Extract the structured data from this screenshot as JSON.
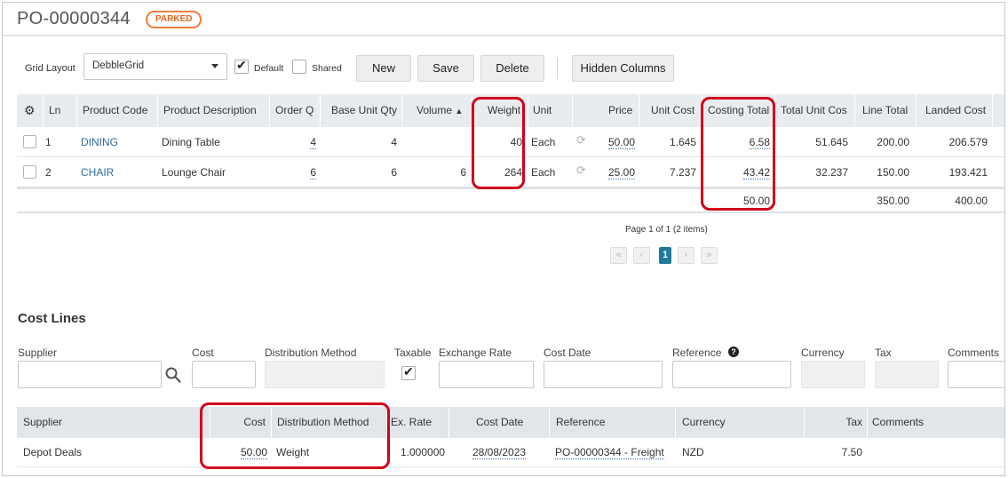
{
  "header": {
    "title": "PO-00000344",
    "status_badge": "PARKED"
  },
  "toolbar": {
    "grid_layout_label": "Grid Layout",
    "grid_layout_value": "DebbleGrid",
    "default_label": "Default",
    "default_checked": true,
    "shared_label": "Shared",
    "shared_checked": false,
    "new_label": "New",
    "save_label": "Save",
    "delete_label": "Delete",
    "hidden_columns_label": "Hidden Columns"
  },
  "lines_grid": {
    "columns": [
      "Ln",
      "Product Code",
      "Product Description",
      "Order Q",
      "Base Unit Qty",
      "Volume",
      "Weight",
      "Unit",
      "Price",
      "Unit Cost",
      "Costing Total",
      "Total Unit Cos",
      "Line Total",
      "Landed Cost"
    ],
    "sort_indicator": "▲",
    "rows": [
      {
        "ln": "1",
        "code": "DINING",
        "description": "Dining Table",
        "order_qty": "4",
        "base_unit_qty": "4",
        "volume": "",
        "weight": "40",
        "unit": "Each",
        "price": "50.00",
        "unit_cost": "1.645",
        "costing_total": "6.58",
        "total_unit_cost": "51.645",
        "line_total": "200.00",
        "landed_cost": "206.579"
      },
      {
        "ln": "2",
        "code": "CHAIR",
        "description": "Lounge Chair",
        "order_qty": "6",
        "base_unit_qty": "6",
        "volume": "6",
        "weight": "264",
        "unit": "Each",
        "price": "25.00",
        "unit_cost": "7.237",
        "costing_total": "43.42",
        "total_unit_cost": "32.237",
        "line_total": "150.00",
        "landed_cost": "193.421"
      }
    ],
    "totals": {
      "costing_total": "50.00",
      "line_total": "350.00",
      "landed_cost": "400.00"
    }
  },
  "pager": {
    "text": "Page 1 of 1 (2 items)",
    "current_page": "1",
    "first": "«",
    "prev": "‹",
    "next": "›",
    "last": "»"
  },
  "cost_lines": {
    "title": "Cost Lines",
    "form": {
      "supplier_label": "Supplier",
      "cost_label": "Cost",
      "distribution_label": "Distribution Method",
      "taxable_label": "Taxable",
      "taxable_checked": true,
      "exchange_rate_label": "Exchange Rate",
      "cost_date_label": "Cost Date",
      "reference_label": "Reference",
      "currency_label": "Currency",
      "tax_label": "Tax",
      "comments_label": "Comments"
    },
    "grid": {
      "columns": [
        "Supplier",
        "Cost",
        "Distribution Method",
        "Ex. Rate",
        "Cost Date",
        "Reference",
        "Currency",
        "Tax",
        "Comments"
      ],
      "rows": [
        {
          "supplier": "Depot Deals",
          "cost": "50.00",
          "distribution_method": "Weight",
          "ex_rate": "1.000000",
          "cost_date": "28/08/2023",
          "reference": "PO-00000344 - Freight",
          "currency": "NZD",
          "tax": "7.50",
          "comments": ""
        }
      ]
    }
  },
  "colors": {
    "accent": "#f07f3c",
    "link": "#2d6a9f",
    "highlight": "#d0021b",
    "header_bg": "#e9ecef",
    "pager_active": "#1f7a9c"
  }
}
